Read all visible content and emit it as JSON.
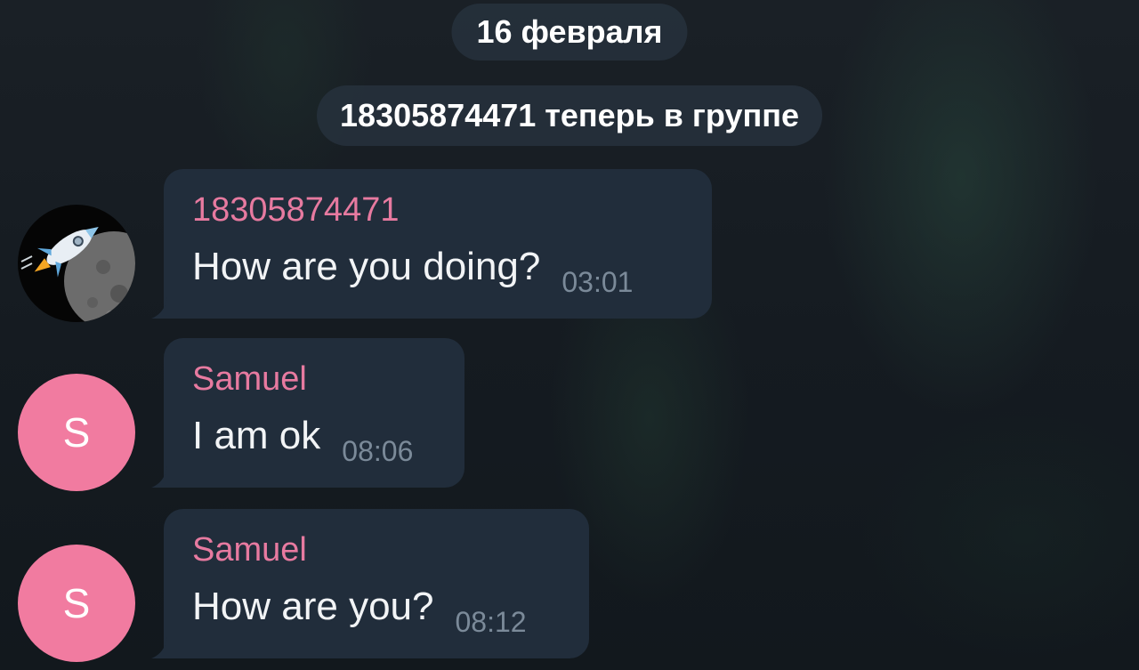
{
  "chat": {
    "date_label": "16 февраля",
    "service_message": "18305874471 теперь в группе",
    "messages": [
      {
        "sender": "18305874471",
        "text": "How are you doing?",
        "time": "03:01",
        "avatar": "rocket-moon-avatar"
      },
      {
        "sender": "Samuel",
        "text": "I am ok",
        "time": "08:06",
        "avatar_letter": "S"
      },
      {
        "sender": "Samuel",
        "text": "How are you?",
        "time": "08:12",
        "avatar_letter": "S"
      }
    ]
  },
  "colors": {
    "bubble": "#212d3b",
    "sender_name": "#e77aa0",
    "avatar_bg": "#f17ba0",
    "time": "#7b8a99",
    "message_text": "#f2f4f6"
  }
}
